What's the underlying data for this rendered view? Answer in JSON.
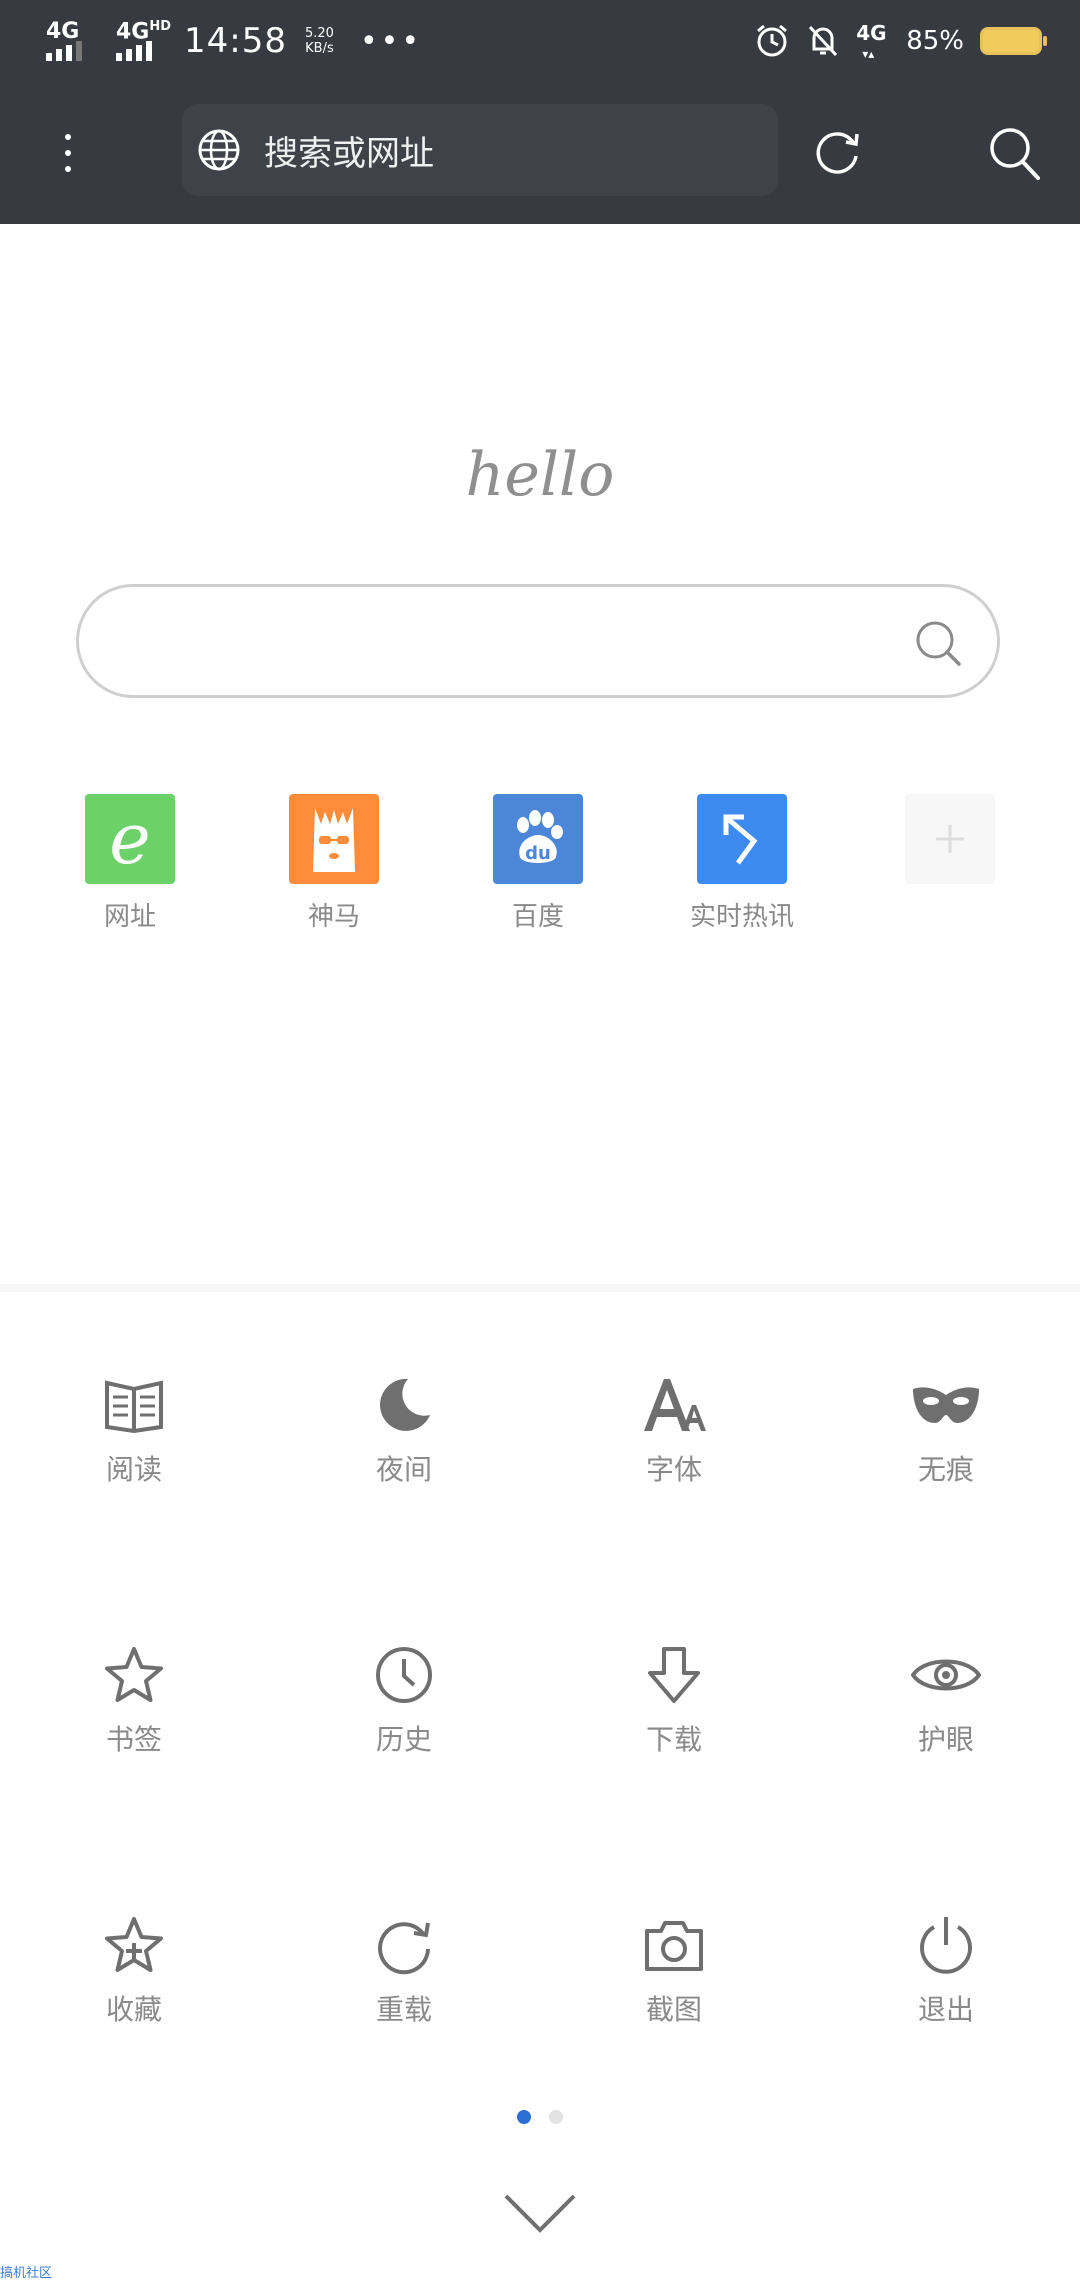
{
  "status_bar": {
    "net1": "4G",
    "net2": "4G",
    "net2_sup": "HD",
    "time": "14:58",
    "speed_value": "5.20",
    "speed_unit": "KB/s",
    "more": "•••",
    "net3": "4G",
    "battery_percent": "85%"
  },
  "toolbar": {
    "address_placeholder": "搜索或网址"
  },
  "home": {
    "greeting": "hello",
    "search_placeholder": "",
    "shortcuts": [
      {
        "label": "网址",
        "icon": "e-icon",
        "color": "#6dd16a"
      },
      {
        "label": "神马",
        "icon": "alpaca-icon",
        "color": "#ff8c3a"
      },
      {
        "label": "百度",
        "icon": "baidu-paw-icon",
        "color": "#4b86d8"
      },
      {
        "label": "实时热讯",
        "icon": "arrow-icon",
        "color": "#3d8bf0"
      },
      {
        "label": "",
        "icon": "plus-icon",
        "color": "#f7f7f7"
      }
    ]
  },
  "menu": {
    "items": [
      {
        "label": "阅读",
        "icon": "book-icon"
      },
      {
        "label": "夜间",
        "icon": "moon-icon"
      },
      {
        "label": "字体",
        "icon": "font-icon"
      },
      {
        "label": "无痕",
        "icon": "mask-icon"
      },
      {
        "label": "书签",
        "icon": "star-icon"
      },
      {
        "label": "历史",
        "icon": "clock-icon"
      },
      {
        "label": "下载",
        "icon": "download-icon"
      },
      {
        "label": "护眼",
        "icon": "eye-icon"
      },
      {
        "label": "收藏",
        "icon": "star-plus-icon"
      },
      {
        "label": "重载",
        "icon": "reload-icon"
      },
      {
        "label": "截图",
        "icon": "camera-icon"
      },
      {
        "label": "退出",
        "icon": "power-icon"
      }
    ],
    "page_active": 1,
    "page_count": 2,
    "active_color": "#2a6fd1",
    "inactive_color": "#e3e3e3"
  },
  "watermark": "搞机社区"
}
